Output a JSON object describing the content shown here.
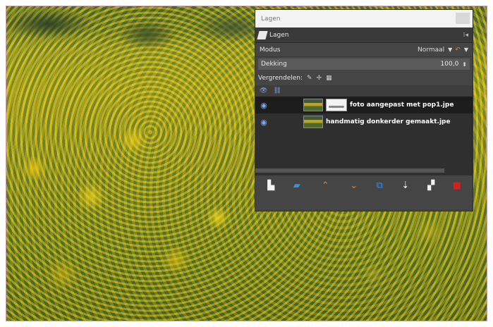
{
  "dialog": {
    "title": "Lagen",
    "tab_label": "Lagen",
    "mode_label": "Modus",
    "mode_value": "Normaal",
    "opacity_label": "Dekking",
    "opacity_value": "100,0",
    "lock_label": "Vergrendelen:",
    "layers": [
      {
        "name": "foto aangepast met pop1.jpe",
        "visible": true,
        "selected": true,
        "has_mask": true
      },
      {
        "name": "handmatig donkerder gemaakt.jpe",
        "visible": true,
        "selected": false,
        "has_mask": false
      }
    ],
    "toolbar_icons": [
      "new-layer-icon",
      "new-layer-group-icon",
      "raise-layer-icon",
      "lower-layer-icon",
      "duplicate-layer-icon",
      "anchor-layer-icon",
      "merge-layer-icon",
      "delete-layer-icon"
    ]
  },
  "colors": {
    "accent_orange": "#f07f1f",
    "eye_blue": "#7fa8e8",
    "delete_red": "#d62020"
  }
}
